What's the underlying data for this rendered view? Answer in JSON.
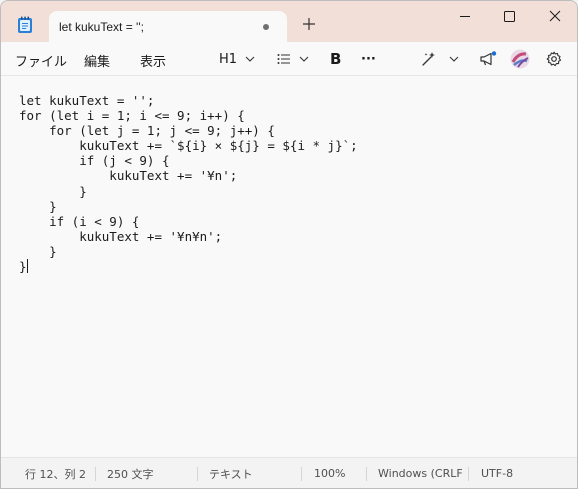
{
  "window": {
    "tab_title": "let kukuText = '';"
  },
  "menu": {
    "file": "ファイル",
    "edit": "編集",
    "view": "表示"
  },
  "toolbar": {
    "heading": "H1",
    "bold": "B",
    "more": "···"
  },
  "editor": {
    "lines": [
      "let kukuText = '';",
      "for (let i = 1; i <= 9; i++) {",
      "    for (let j = 1; j <= 9; j++) {",
      "        kukuText += `${i} × ${j} = ${i * j}`;",
      "        if (j < 9) {",
      "            kukuText += '¥n';",
      "        }",
      "    }",
      "    if (i < 9) {",
      "        kukuText += '¥n¥n';",
      "    }",
      "}"
    ]
  },
  "status": {
    "position": "行 12、列 2",
    "char_count": "250 文字",
    "format": "テキスト",
    "zoom": "100%",
    "line_ending": "Windows (CRLF",
    "encoding": "UTF-8"
  },
  "colors": {
    "titlebar": "#f1dfd8",
    "accent": "#1a6fd1"
  },
  "icons": [
    "notepad-icon",
    "unsaved-dot-icon",
    "plus-icon",
    "minimize-icon",
    "maximize-icon",
    "close-icon",
    "list-icon",
    "chevron-down-icon",
    "copilot-icon",
    "megaphone-icon",
    "avatar",
    "gear-icon"
  ]
}
